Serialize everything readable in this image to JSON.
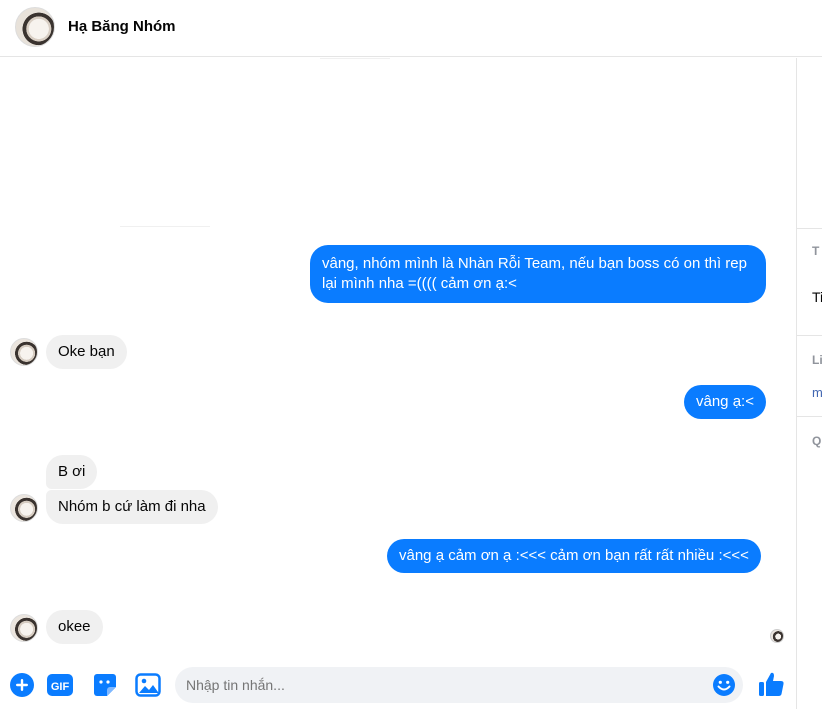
{
  "header": {
    "title": "Hạ Băng Nhóm",
    "avatar_icon": "user-avatar"
  },
  "messages": [
    {
      "direction": "out",
      "text": "vâng, nhóm mình là Nhàn Rỗi Team, nếu bạn boss có on thì rep lại mình nha =(((( cảm ơn ạ:<"
    },
    {
      "direction": "in",
      "text": "Oke bạn"
    },
    {
      "direction": "out",
      "text": "vâng ạ:<"
    },
    {
      "direction": "in",
      "text": "B ơi"
    },
    {
      "direction": "in",
      "text": "Nhóm b cứ làm đi nha"
    },
    {
      "direction": "out",
      "text": "vâng ạ cảm ơn ạ :<<< cảm ơn bạn rất rất nhiều :<<<"
    },
    {
      "direction": "in",
      "text": "okee"
    }
  ],
  "side_panel": {
    "section1": "T",
    "item1": "Ti",
    "section2": "Li",
    "link": "m",
    "section3": "Q"
  },
  "composer": {
    "placeholder": "Nhập tin nhắn...",
    "icons": [
      "plus-icon",
      "gif-icon",
      "sticker-icon",
      "image-icon",
      "emoji-icon",
      "like-icon"
    ],
    "gif_label": "GIF"
  },
  "colors": {
    "accent": "#0a7cff",
    "incoming_bubble": "#f0f0f0",
    "input_bg": "#f0f2f5"
  }
}
